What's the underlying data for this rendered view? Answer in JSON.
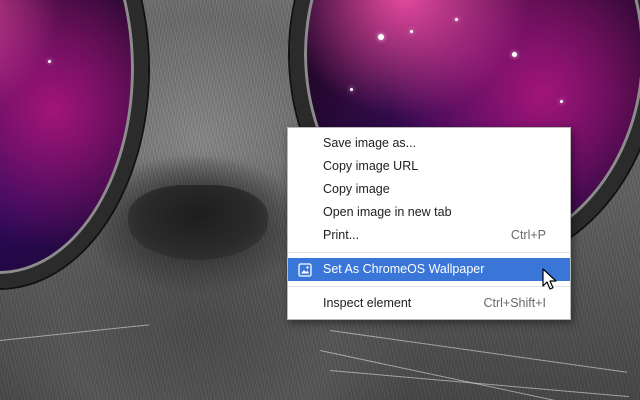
{
  "context_menu": {
    "items": [
      {
        "label": "Save image as...",
        "shortcut": ""
      },
      {
        "label": "Copy image URL",
        "shortcut": ""
      },
      {
        "label": "Copy image",
        "shortcut": ""
      },
      {
        "label": "Open image in new tab",
        "shortcut": ""
      },
      {
        "label": "Print...",
        "shortcut": "Ctrl+P"
      },
      {
        "label": "Set As ChromeOS Wallpaper",
        "shortcut": "",
        "icon": "wallpaper-icon",
        "highlighted": true
      },
      {
        "label": "Inspect element",
        "shortcut": "Ctrl+Shift+I"
      }
    ]
  },
  "colors": {
    "highlight": "#3a75d8",
    "menu_background": "#ffffff",
    "shortcut_text": "#6a6a6a"
  }
}
